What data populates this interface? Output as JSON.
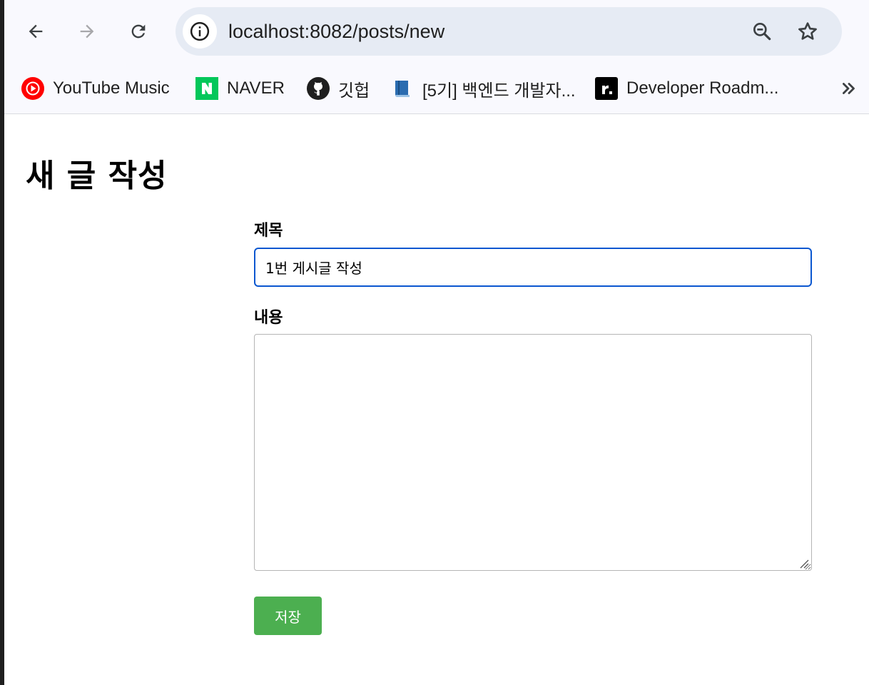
{
  "browser": {
    "url": "localhost:8082/posts/new",
    "toolbar_icons": {
      "back": "arrow-left-icon",
      "forward": "arrow-right-icon",
      "reload": "reload-icon",
      "site_info": "info-icon",
      "zoom": "zoom-icon",
      "bookmark": "star-icon"
    },
    "bookmarks": [
      {
        "label": "YouTube Music",
        "icon": "youtube-music-icon",
        "color": "#ff0000"
      },
      {
        "label": "NAVER",
        "icon": "naver-icon",
        "color": "#03c75a"
      },
      {
        "label": "깃헙",
        "icon": "github-icon",
        "color": "#1f1f1f"
      },
      {
        "label": "[5기] 백엔드 개발자...",
        "icon": "book-icon",
        "color": "#2b6cb0"
      },
      {
        "label": "Developer Roadm...",
        "icon": "roadmap-icon",
        "color": "#000000"
      }
    ],
    "overflow_icon": "chevron-double-right-icon"
  },
  "page": {
    "title": "새 글 작성",
    "form": {
      "title_label": "제목",
      "title_value": "1번 게시글 작성",
      "content_label": "내용",
      "content_value": "",
      "save_label": "저장"
    }
  },
  "colors": {
    "save_button": "#4caf50",
    "focus_border": "#0b57d0",
    "omnibox": "#e6ebf4"
  }
}
